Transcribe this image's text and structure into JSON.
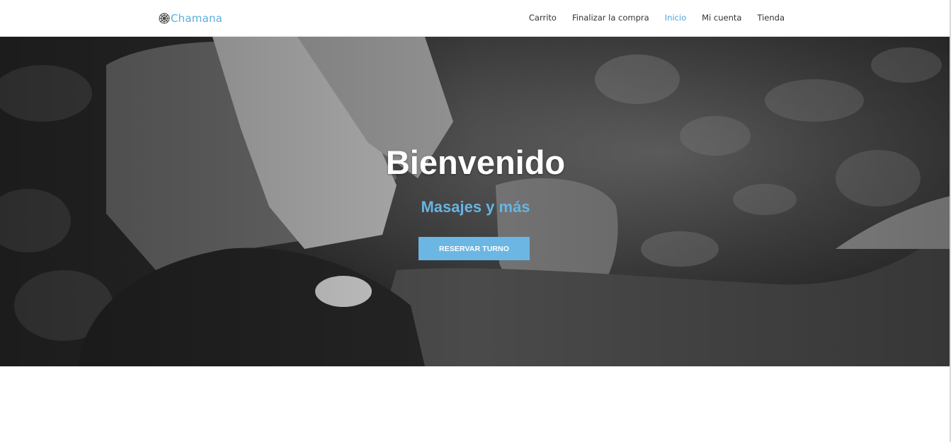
{
  "header": {
    "logo_text": "Chamana",
    "logo_icon": "mandala-icon",
    "nav": [
      {
        "label": "Carrito",
        "active": false
      },
      {
        "label": "Finalizar la compra",
        "active": false
      },
      {
        "label": "Inicio",
        "active": true
      },
      {
        "label": "Mi cuenta",
        "active": false
      },
      {
        "label": "Tienda",
        "active": false
      }
    ]
  },
  "hero": {
    "title": "Bienvenido",
    "subtitle": "Masajes y más",
    "button_label": "RESERVAR TURNO",
    "background_image": "grayscale-massage-photo"
  },
  "colors": {
    "accent": "#67b4e2",
    "nav_active": "#4f9fd8",
    "nav_text": "#333333",
    "button_bg": "#6bb6e3"
  }
}
